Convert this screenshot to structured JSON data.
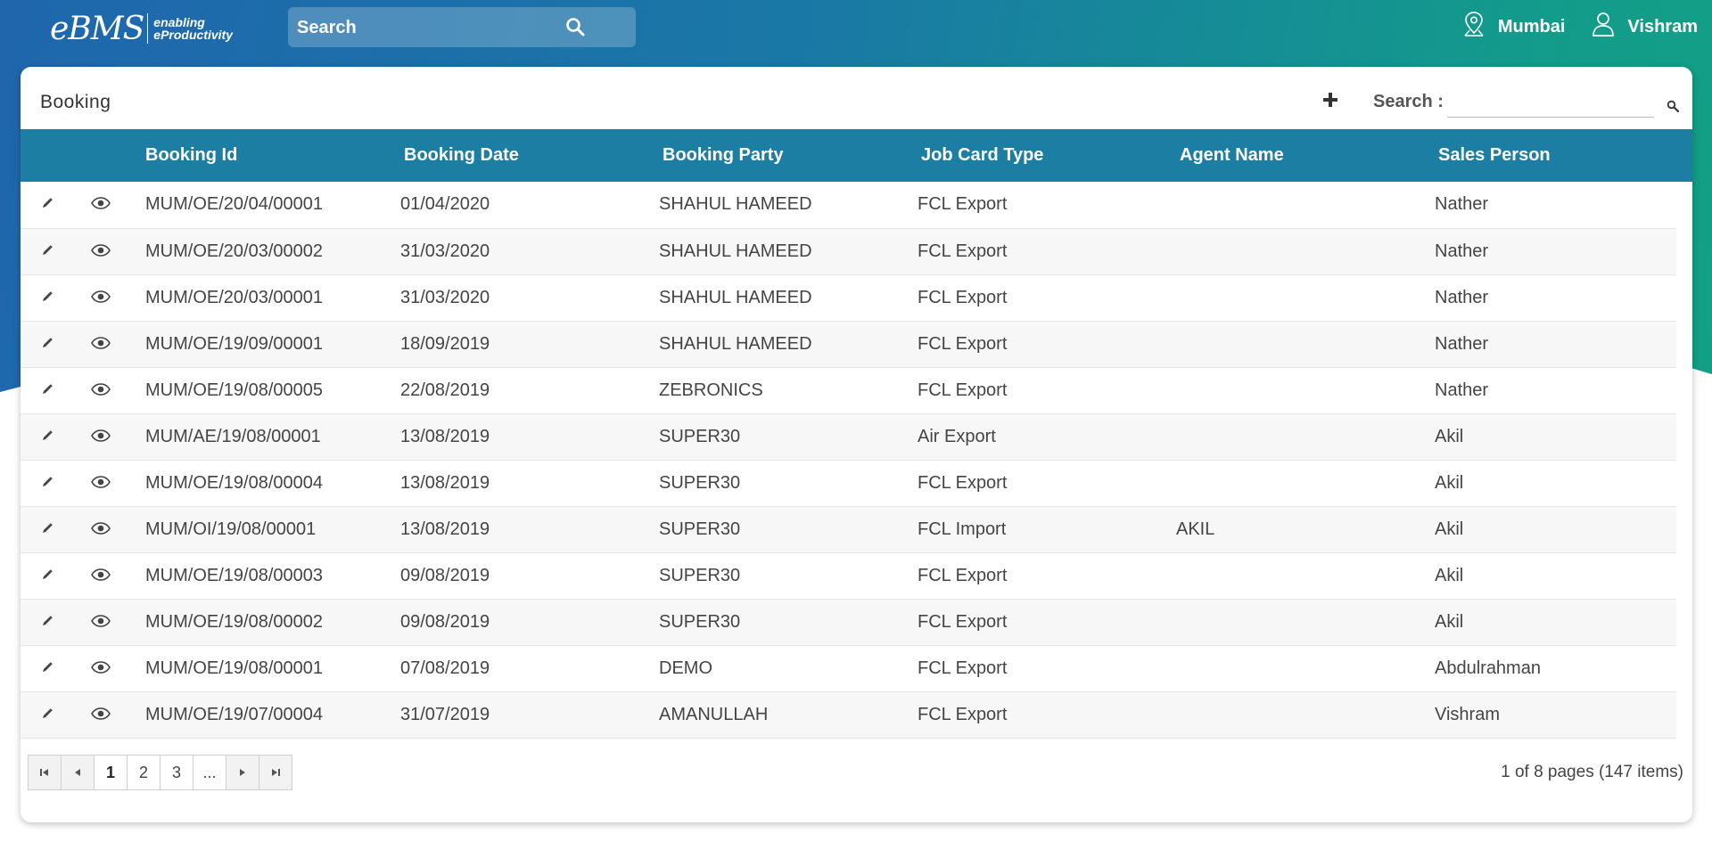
{
  "brand": {
    "name": "eBMS",
    "tagline_1": "enabling",
    "tagline_2": "eProductivity"
  },
  "topbar": {
    "search_placeholder": "Search",
    "location": "Mumbai",
    "user": "Vishram"
  },
  "page": {
    "title": "Booking",
    "search_label": "Search :",
    "search_value": ""
  },
  "table": {
    "columns": [
      "Booking Id",
      "Booking Date",
      "Booking Party",
      "Job Card Type",
      "Agent Name",
      "Sales Person"
    ],
    "rows": [
      [
        "MUM/OE/20/04/00001",
        "01/04/2020",
        "SHAHUL HAMEED",
        "FCL Export",
        "",
        "Nather"
      ],
      [
        "MUM/OE/20/03/00002",
        "31/03/2020",
        "SHAHUL HAMEED",
        "FCL Export",
        "",
        "Nather"
      ],
      [
        "MUM/OE/20/03/00001",
        "31/03/2020",
        "SHAHUL HAMEED",
        "FCL Export",
        "",
        "Nather"
      ],
      [
        "MUM/OE/19/09/00001",
        "18/09/2019",
        "SHAHUL HAMEED",
        "FCL Export",
        "",
        "Nather"
      ],
      [
        "MUM/OE/19/08/00005",
        "22/08/2019",
        "ZEBRONICS",
        "FCL Export",
        "",
        "Nather"
      ],
      [
        "MUM/AE/19/08/00001",
        "13/08/2019",
        "SUPER30",
        "Air Export",
        "",
        "Akil"
      ],
      [
        "MUM/OE/19/08/00004",
        "13/08/2019",
        "SUPER30",
        "FCL Export",
        "",
        "Akil"
      ],
      [
        "MUM/OI/19/08/00001",
        "13/08/2019",
        "SUPER30",
        "FCL Import",
        "AKIL",
        "Akil"
      ],
      [
        "MUM/OE/19/08/00003",
        "09/08/2019",
        "SUPER30",
        "FCL Export",
        "",
        "Akil"
      ],
      [
        "MUM/OE/19/08/00002",
        "09/08/2019",
        "SUPER30",
        "FCL Export",
        "",
        "Akil"
      ],
      [
        "MUM/OE/19/08/00001",
        "07/08/2019",
        "DEMO",
        "FCL Export",
        "",
        "Abdulrahman"
      ],
      [
        "MUM/OE/19/07/00004",
        "31/07/2019",
        "AMANULLAH",
        "FCL Export",
        "",
        "Vishram"
      ]
    ]
  },
  "pager": {
    "pages": [
      "1",
      "2",
      "3",
      "..."
    ],
    "current": "1",
    "info": "1 of 8 pages (147 items)"
  },
  "icons": {
    "edit": "pencil-icon",
    "view": "eye-icon",
    "search": "search-icon",
    "location": "location-pin-icon",
    "user": "user-icon",
    "add": "plus-icon"
  },
  "colors": {
    "header_gradient_start": "#1f66ad",
    "header_gradient_end": "#12a085",
    "table_header": "#1d7ea3"
  }
}
